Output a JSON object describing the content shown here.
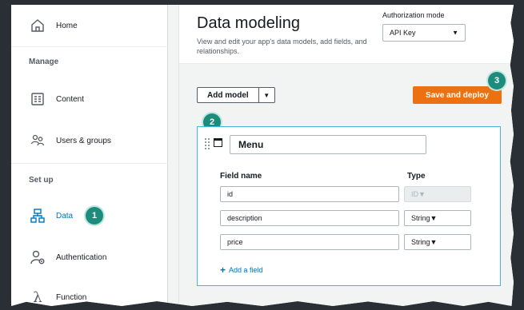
{
  "sidebar": {
    "home": "Home",
    "manage_label": "Manage",
    "content": "Content",
    "users_groups": "Users & groups",
    "setup_label": "Set up",
    "data": "Data",
    "authentication": "Authentication",
    "function": "Function"
  },
  "header": {
    "title": "Data modeling",
    "subtitle": "View and edit your app's data models, add fields, and relationships.",
    "auth_mode_label": "Authorization mode",
    "auth_mode_value": "API Key"
  },
  "toolbar": {
    "add_model": "Add model",
    "save_deploy": "Save and deploy"
  },
  "model": {
    "name": "Menu",
    "col_field_name": "Field name",
    "col_type": "Type",
    "fields": [
      {
        "name": "id",
        "type": "ID"
      },
      {
        "name": "description",
        "type": "String"
      },
      {
        "name": "price",
        "type": "String"
      }
    ],
    "add_field": "Add a field"
  },
  "callouts": {
    "one": "1",
    "two": "2",
    "three": "3"
  },
  "colors": {
    "accent": "#0073bb",
    "deploy": "#ec7211",
    "badge": "#1d8c7c",
    "card_border": "#44b9d6"
  }
}
